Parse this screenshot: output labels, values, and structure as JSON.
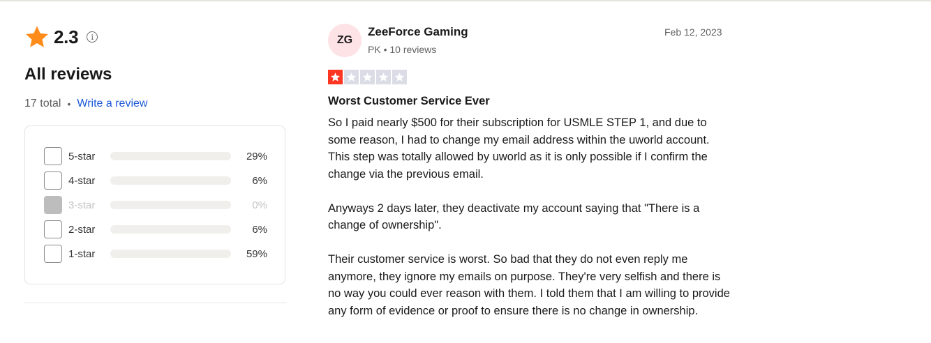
{
  "summary": {
    "rating": "2.3",
    "info_symbol": "i",
    "heading": "All reviews",
    "total": "17 total",
    "separator": "•",
    "write_review": "Write a review",
    "star_color": "#ff8c1a",
    "distribution": [
      {
        "label": "5-star",
        "percent_text": "29%",
        "fraction": 0.29,
        "disabled": false
      },
      {
        "label": "4-star",
        "percent_text": "6%",
        "fraction": 0.06,
        "disabled": false
      },
      {
        "label": "3-star",
        "percent_text": "0%",
        "fraction": 0.0,
        "disabled": true
      },
      {
        "label": "2-star",
        "percent_text": "6%",
        "fraction": 0.06,
        "disabled": false
      },
      {
        "label": "1-star",
        "percent_text": "59%",
        "fraction": 0.59,
        "disabled": false
      }
    ]
  },
  "review": {
    "avatar_initials": "ZG",
    "reviewer_name": "ZeeForce Gaming",
    "reviewer_meta": "PK • 10 reviews",
    "date": "Feb 12, 2023",
    "stars_filled": 1,
    "stars_total": 5,
    "star_fill_color": "#ff3722",
    "title": "Worst Customer Service Ever",
    "body": [
      "So I paid nearly $500 for their subscription for USMLE STEP 1, and due to some reason, I had to change my email address within the uworld account. This step was totally allowed by uworld as it is only possible if I confirm the change via the previous email.",
      "Anyways 2 days later, they deactivate my account saying that \"There is a change of ownership\".",
      "Their customer service is worst. So bad that they do not even reply me anymore, they ignore my emails on purpose. They're very selfish and there is no way you could ever reason with them. I told them that I am willing to provide any form of evidence or proof to ensure there is no change in ownership."
    ]
  }
}
